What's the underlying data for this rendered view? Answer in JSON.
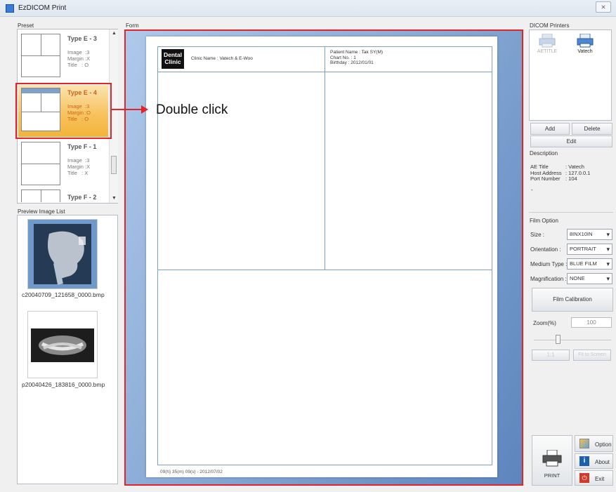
{
  "window": {
    "title": "EzDICOM Print",
    "close_glyph": "⨯"
  },
  "preset": {
    "label": "Preset",
    "items": [
      {
        "name": "Type E - 3",
        "meta": "Image  :3\nMargin :X\nTitle   : O"
      },
      {
        "name": "Type E - 4",
        "meta": "Image  :3\nMargin :O\nTitle   : O"
      },
      {
        "name": "Type F - 1",
        "meta": "Image  :3\nMargin :X\nTitle   : X"
      },
      {
        "name": "Type F - 2",
        "meta": ""
      }
    ]
  },
  "preview": {
    "label": "Preview Image List",
    "items": [
      {
        "name": "c20040709_121658_0000.bmp"
      },
      {
        "name": "p20040426_183816_0000.bmp"
      }
    ]
  },
  "form": {
    "label": "Form",
    "logo_line1": "Dental",
    "logo_line2": "Clinic",
    "clinic_name": "Clinic Name : Vatech & E-Woo",
    "patient_name": "Patient Name : Tak SY(M)",
    "chart_no": "Chart No. : 1",
    "birthday": "Birthday : 2012/01/01",
    "footer_stamp": "09(h) 35(m) 09(s) - 2012/07/02"
  },
  "annotation": {
    "text": "Double click"
  },
  "printers": {
    "label": "DICOM Printers",
    "items": [
      {
        "name": "AETITLE"
      },
      {
        "name": "Vatech"
      }
    ],
    "add_label": "Add",
    "delete_label": "Delete",
    "edit_label": "Edit"
  },
  "description": {
    "label": "Description",
    "ae_title_key": "AE Title",
    "ae_title_val": ": Vatech",
    "host_key": "Host Address",
    "host_val": ": 127.0.0.1",
    "port_key": "Port Number",
    "port_val": ": 104",
    "dash": "-"
  },
  "film_option": {
    "label": "Film Option",
    "size_label": "Size :",
    "size_value": "8INX10IN",
    "orientation_label": "Orientation :",
    "orientation_value": "PORTRAIT",
    "medium_label": "Medium Type :",
    "medium_value": "BLUE FILM",
    "magnification_label": "Magnification :",
    "magnification_value": "NONE",
    "calibration_label": "Film Calibration"
  },
  "zoom": {
    "label": "Zoom(%)",
    "value": "100",
    "btn1": "1:1",
    "btn2": "Fit to Screen"
  },
  "actions": {
    "print_label": "PRINT",
    "option_label": "Option",
    "about_label": "About",
    "exit_label": "Exit"
  }
}
